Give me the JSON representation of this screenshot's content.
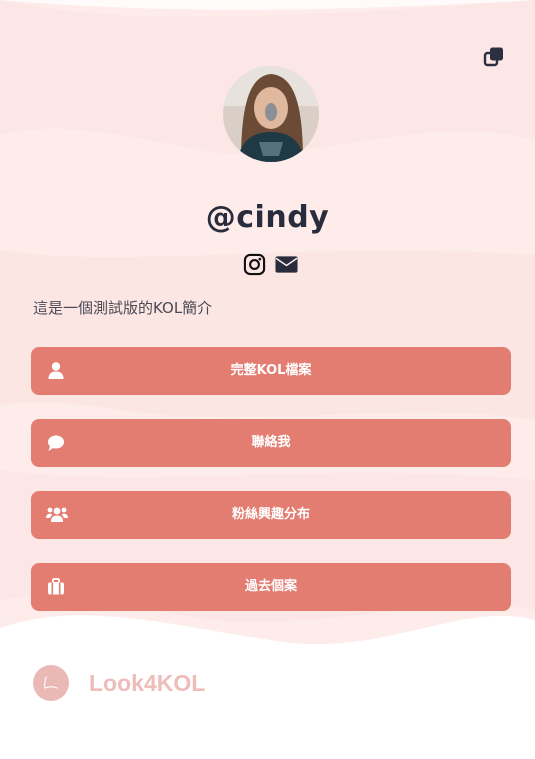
{
  "profile": {
    "handle": "@cindy",
    "bio": "這是一個測試版的KOL簡介"
  },
  "socials": [
    {
      "icon": "instagram-icon"
    },
    {
      "icon": "envelope-icon"
    }
  ],
  "buttons": [
    {
      "label": "完整KOL檔案",
      "icon": "user-icon"
    },
    {
      "label": "聯絡我",
      "icon": "chat-bubble-icon"
    },
    {
      "label": "粉絲興趣分布",
      "icon": "users-icon"
    },
    {
      "label": "過去個案",
      "icon": "briefcase-icon"
    }
  ],
  "brand": {
    "name": "Look4KOL"
  },
  "colors": {
    "accent": "#e37d72",
    "background": "#fdeceb",
    "brand": "#efbdb9",
    "text": "#282c3c"
  }
}
